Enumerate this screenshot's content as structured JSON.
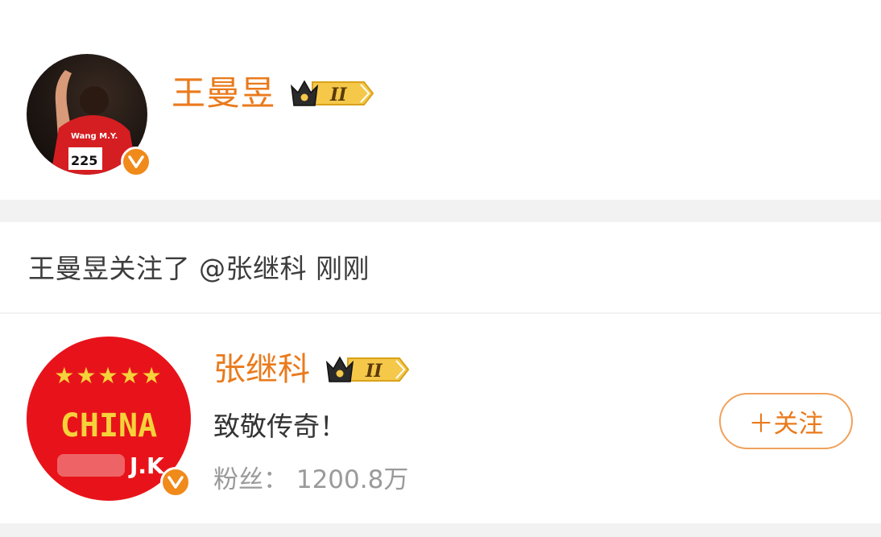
{
  "header": {
    "user_name": "王曼昱",
    "level_badge": "II"
  },
  "activity": {
    "text": "王曼昱关注了 @张继科 刚刚"
  },
  "followed_user": {
    "name": "张继科",
    "level_badge": "II",
    "bio": "致敬传奇！",
    "fans": "粉丝： 1200.8万",
    "follow_button": "＋关注"
  },
  "avatar_1": {
    "jersey_name": "Wang M.Y.",
    "bib_number": "225"
  },
  "avatar_2": {
    "stars": "★★★★★",
    "word": "CHINA",
    "initials": "J.K"
  },
  "verified_mark": "V",
  "colors": {
    "accent_orange": "#ea7a1c",
    "badge_gold": "#f5c84a",
    "avatar_red": "#e8131a",
    "separator": "#f2f2f2"
  }
}
